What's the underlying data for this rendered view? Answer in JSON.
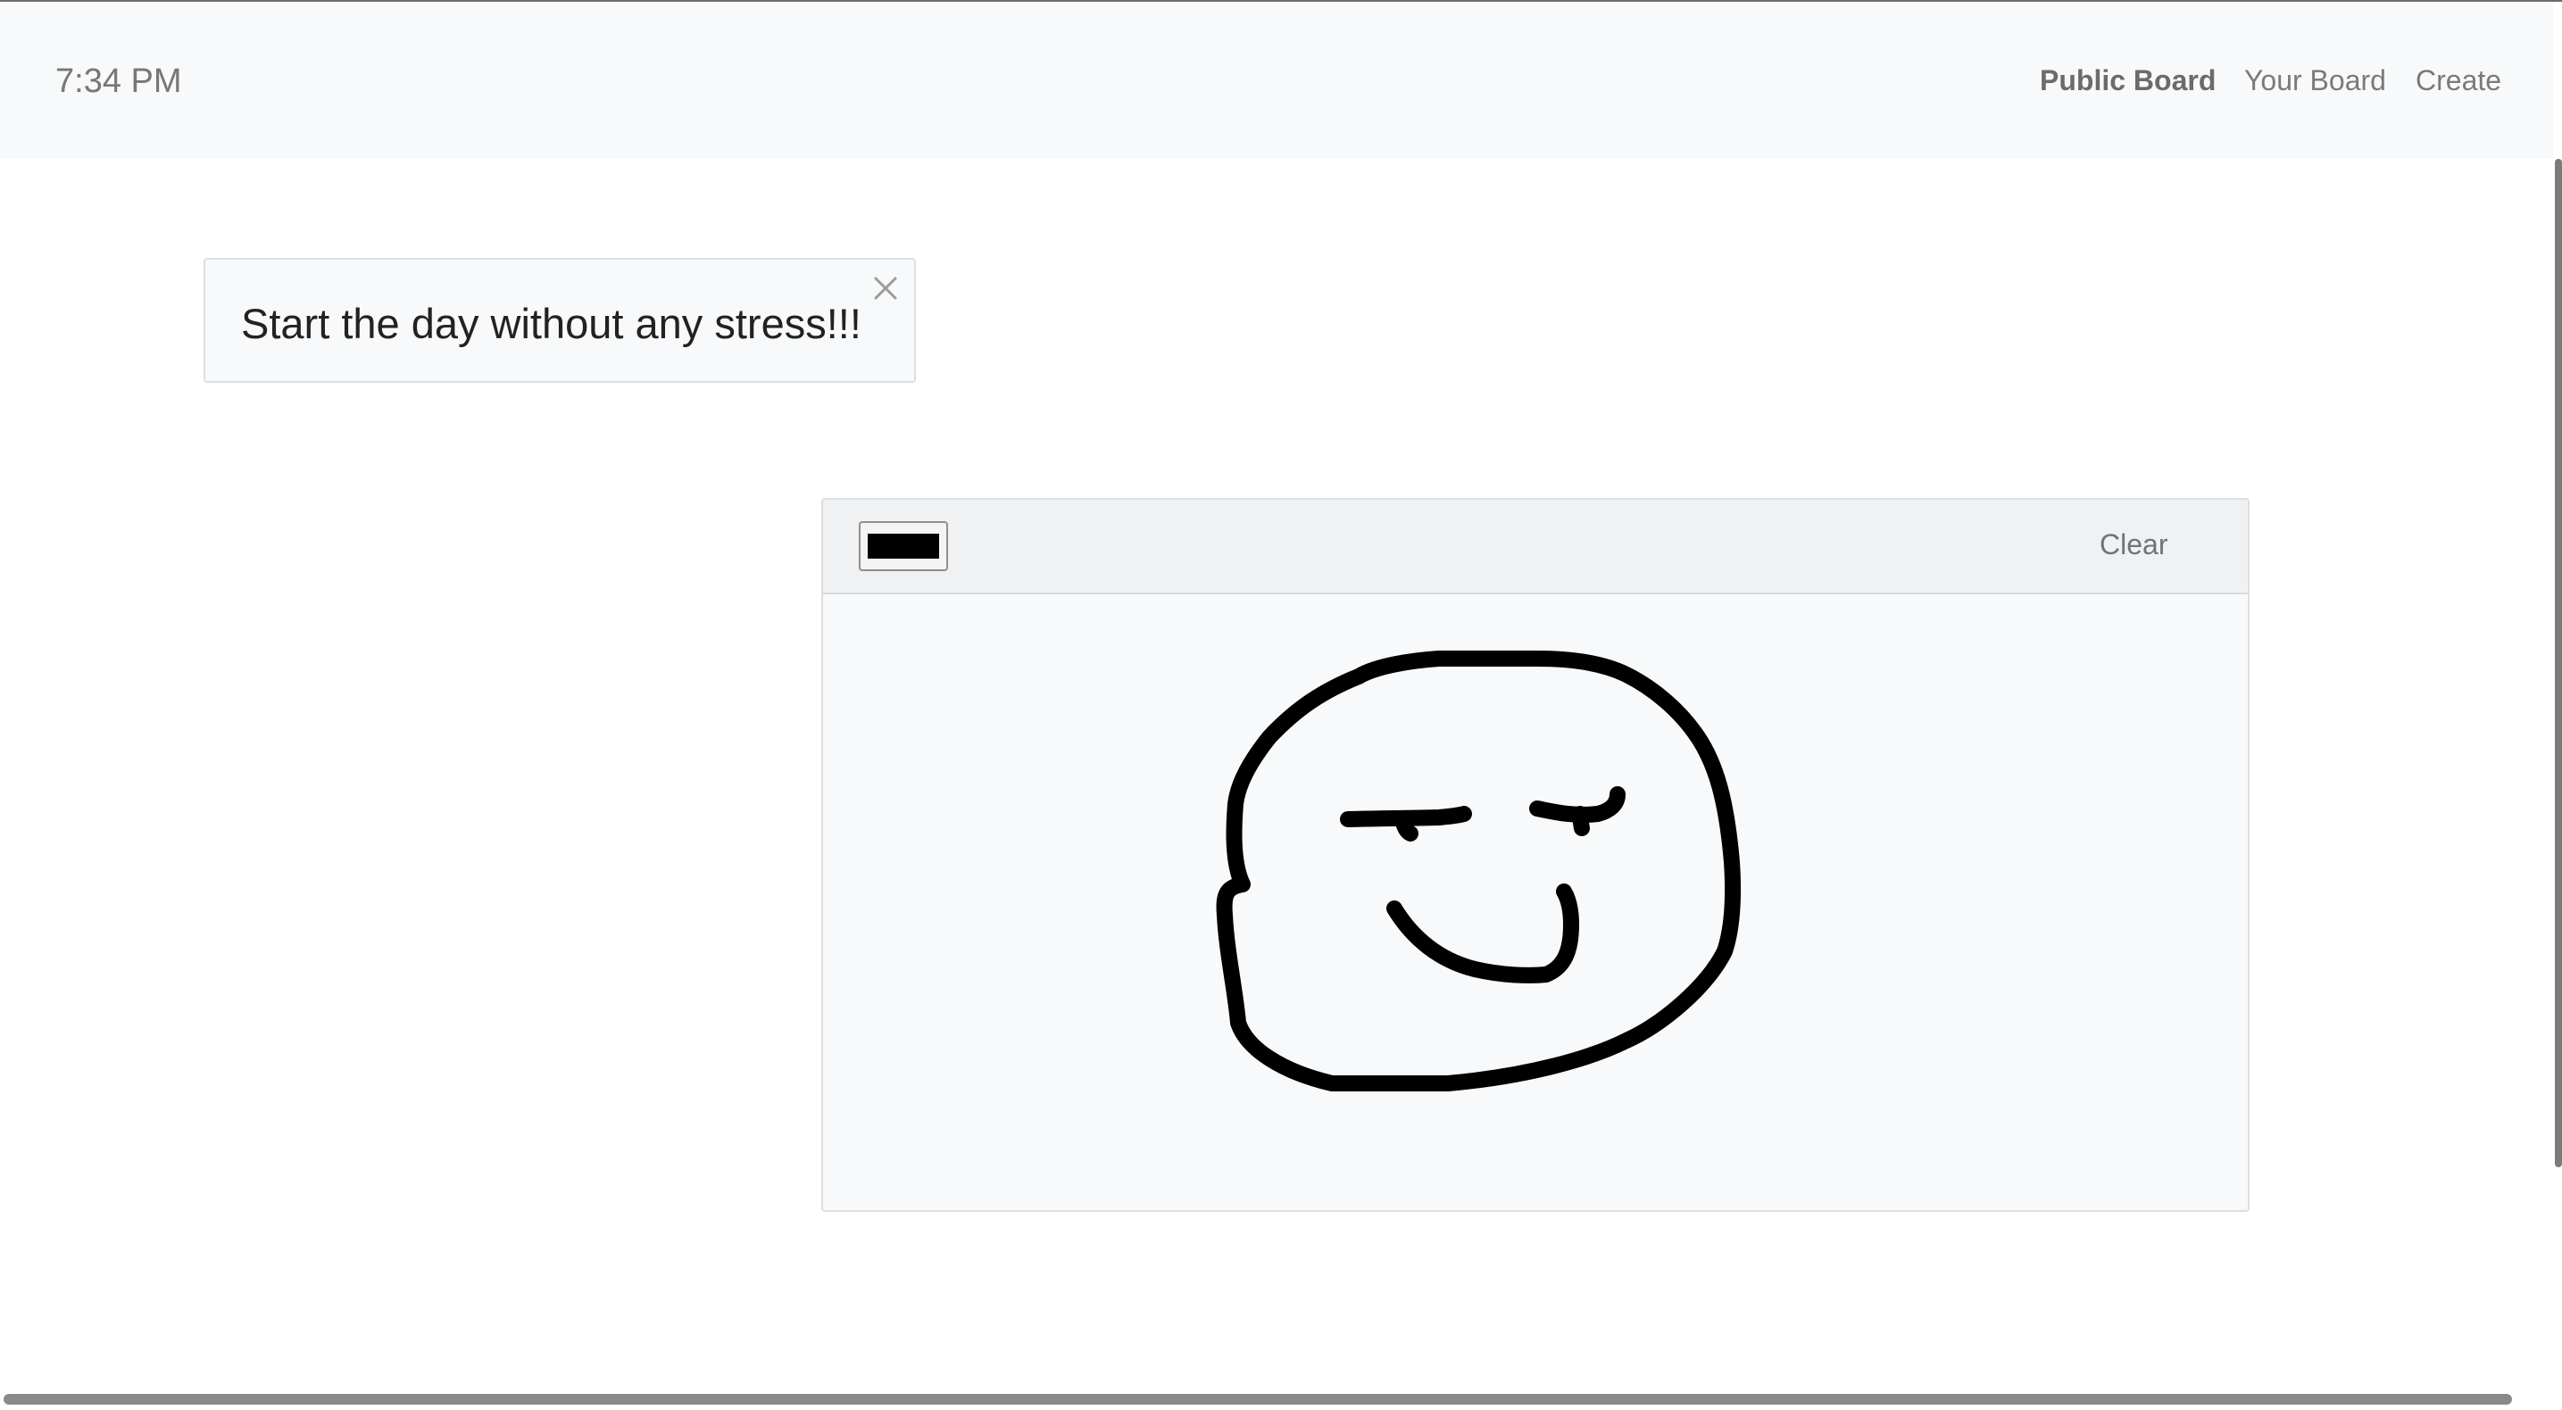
{
  "header": {
    "time": "7:34 PM",
    "nav": {
      "public_board": "Public Board",
      "your_board": "Your Board",
      "create": "Create"
    }
  },
  "alert": {
    "message": "Start the day without any stress!!!",
    "close_icon": "close-icon"
  },
  "board": {
    "pen_color": "#000000",
    "clear_label": "Clear",
    "drawing_icon": "smiley-face-doodle"
  },
  "colors": {
    "navbar_bg": "#f8f9fa",
    "board_bg": "#f8f9fa",
    "toolbar_bg": "#f0f1f2",
    "ink": "#000000"
  }
}
